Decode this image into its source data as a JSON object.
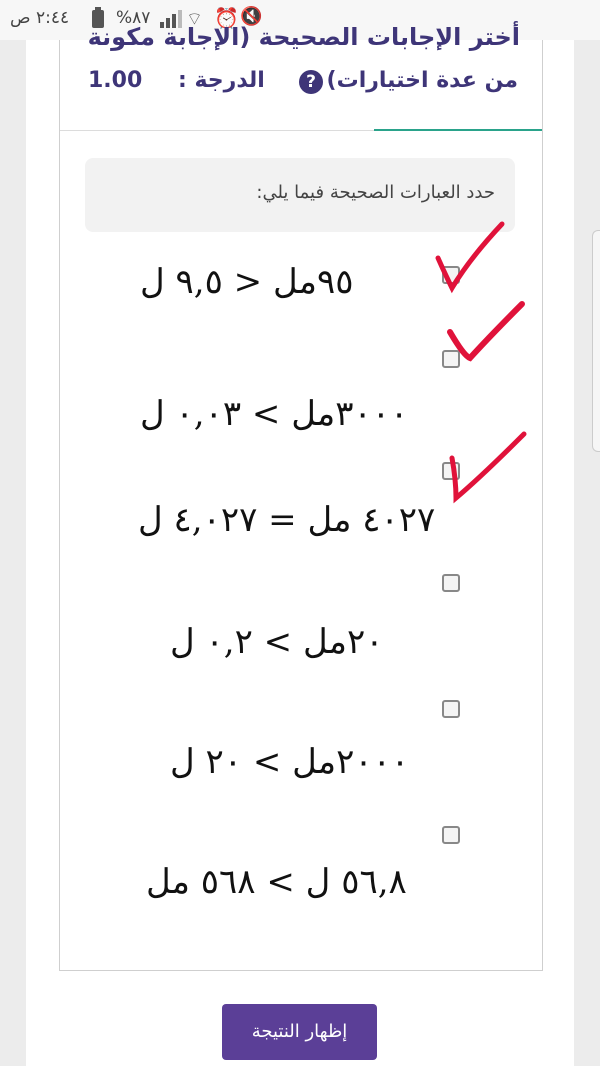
{
  "status_bar": {
    "time": "٢:٤٤ ص",
    "battery_percent": "%٨٧"
  },
  "question": {
    "title_line1": "أختر الإجابات الصحيحة (الإجابة مكونة",
    "title_line2": "من عدة اختيارات)",
    "grade_label": "الدرجة :",
    "grade_value": "1.00",
    "prompt": "حدد العبارات الصحيحة فيما يلي:",
    "options": [
      {
        "text": "٩٥مل < ٩,٥ ل",
        "checked_mark": true
      },
      {
        "text": "٣٠٠٠مل > ٠,٠٣ ل",
        "checked_mark": true
      },
      {
        "text": "٤٠٢٧ مل = ٤,٠٢٧ ل",
        "checked_mark": true
      },
      {
        "text": "٢٠مل > ٠,٢ ل",
        "checked_mark": false
      },
      {
        "text": "٢٠٠٠مل > ٢٠ ل",
        "checked_mark": false
      },
      {
        "text": "٥٦,٨ ل > ٥٦٨ مل",
        "checked_mark": false
      }
    ]
  },
  "buttons": {
    "show_result": "إظهار النتيجة"
  },
  "colors": {
    "accent": "#3e3578",
    "button": "#5b3f97",
    "check_mark": "#e0123a",
    "divider_accent": "#2aa38b"
  }
}
